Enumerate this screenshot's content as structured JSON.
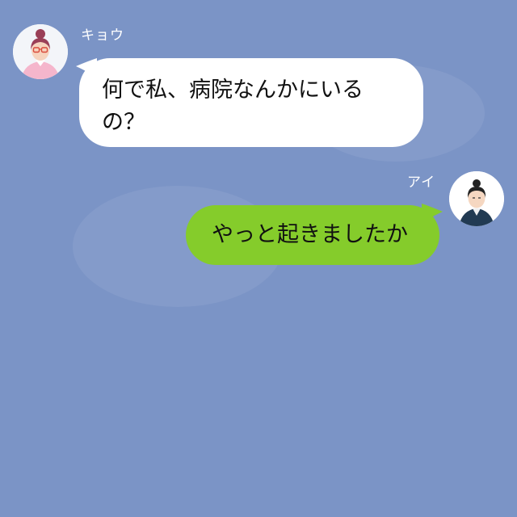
{
  "messages": [
    {
      "side": "left",
      "sender": "キョウ",
      "avatar_icon": "woman-glasses-avatar-icon",
      "text": "何で私、病院なんかにいるの？"
    },
    {
      "side": "right",
      "sender": "アイ",
      "avatar_icon": "woman-dark-hair-avatar-icon",
      "text": "やっと起きましたか"
    }
  ],
  "colors": {
    "background": "#7b94c6",
    "incoming_bubble": "#ffffff",
    "outgoing_bubble": "#85cc2b"
  }
}
